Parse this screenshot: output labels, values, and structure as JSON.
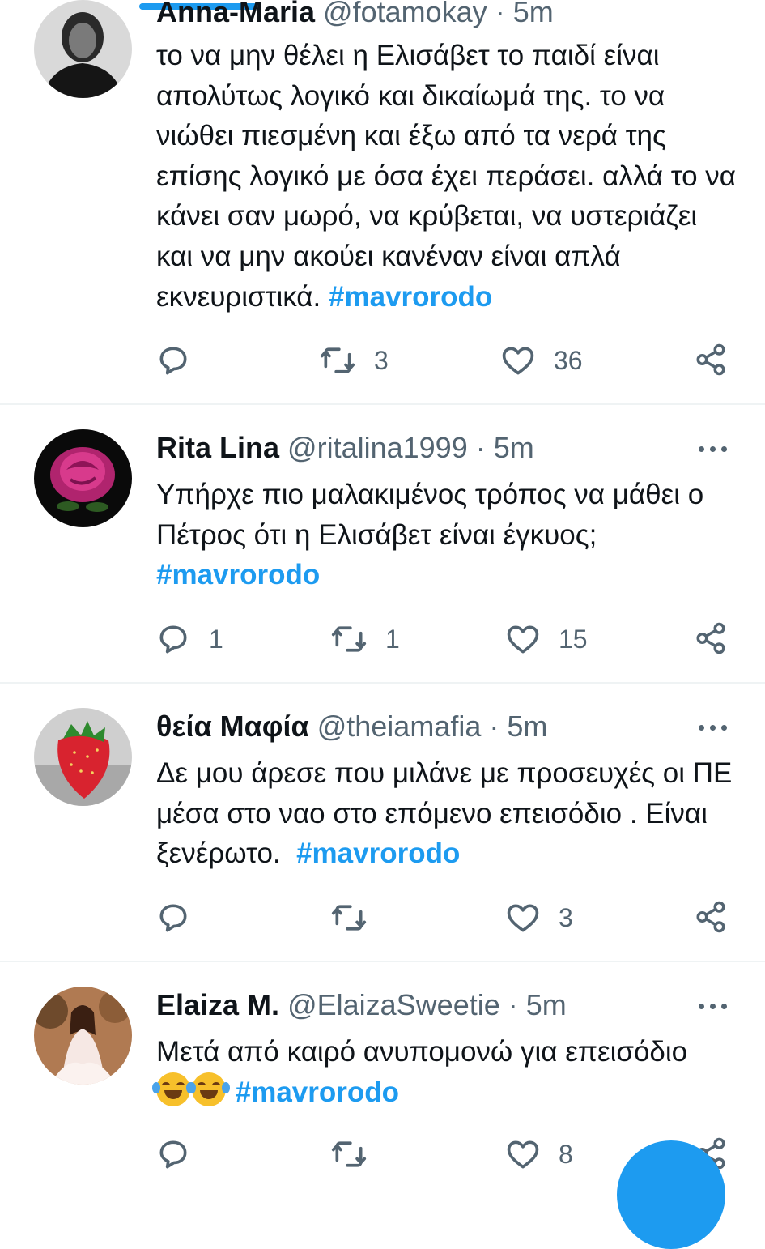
{
  "colors": {
    "accent": "#1d9bf0",
    "text": "#0f1419",
    "muted": "#536471",
    "separator": "#eff3f4"
  },
  "tweets": [
    {
      "name": "Anna-Maria",
      "handle": "@fotamokay",
      "dot": "·",
      "time": "5m",
      "avatar": "woman-portrait-avatar",
      "text": "το να μην θέλει η Ελισάβετ το παιδί είναι απολύτως λογικό και δικαίωμά της. το να νιώθει πιεσμένη και έξω από τα νερά της επίσης λογικό με όσα έχει περάσει. αλλά το να κάνει σαν μωρό, να κρύβεται, να υστεριάζει και να μην ακούει κανέναν είναι απλά εκνευριστικά.",
      "hashtag": "#mavrorodo",
      "replies": "",
      "retweets": "3",
      "likes": "36"
    },
    {
      "name": "Rita Lina",
      "handle": "@ritalina1999",
      "dot": "·",
      "time": "5m",
      "avatar": "pink-rose-avatar",
      "text": "Υπήρχε πιο μαλακιμένος τρόπος να μάθει ο Πέτρος ότι η Ελισάβετ είναι έγκυος;",
      "hashtag": "#mavrorodo",
      "replies": "1",
      "retweets": "1",
      "likes": "15"
    },
    {
      "name": "θεία Μαφία",
      "handle": "@theiamafia",
      "dot": "·",
      "time": "5m",
      "avatar": "strawberry-avatar",
      "text": "Δε μου άρεσε που μιλάνε με προσευχές οι ΠΕ μέσα στο ναο στο επόμενο επεισόδιο . Είναι ξενέρωτο.",
      "hashtag": "#mavrorodo",
      "replies": "",
      "retweets": "",
      "likes": "3"
    },
    {
      "name": "Elaiza M.",
      "handle": "@ElaizaSweetie",
      "dot": "·",
      "time": "5m",
      "avatar": "woman-in-dress-avatar",
      "text": "Μετά από καιρό ανυπομονώ για επεισόδιο",
      "emoji": "rolling-on-floor-laughing-emoji",
      "hashtag": "#mavrorodo",
      "replies": "",
      "retweets": "",
      "likes": "8"
    }
  ]
}
